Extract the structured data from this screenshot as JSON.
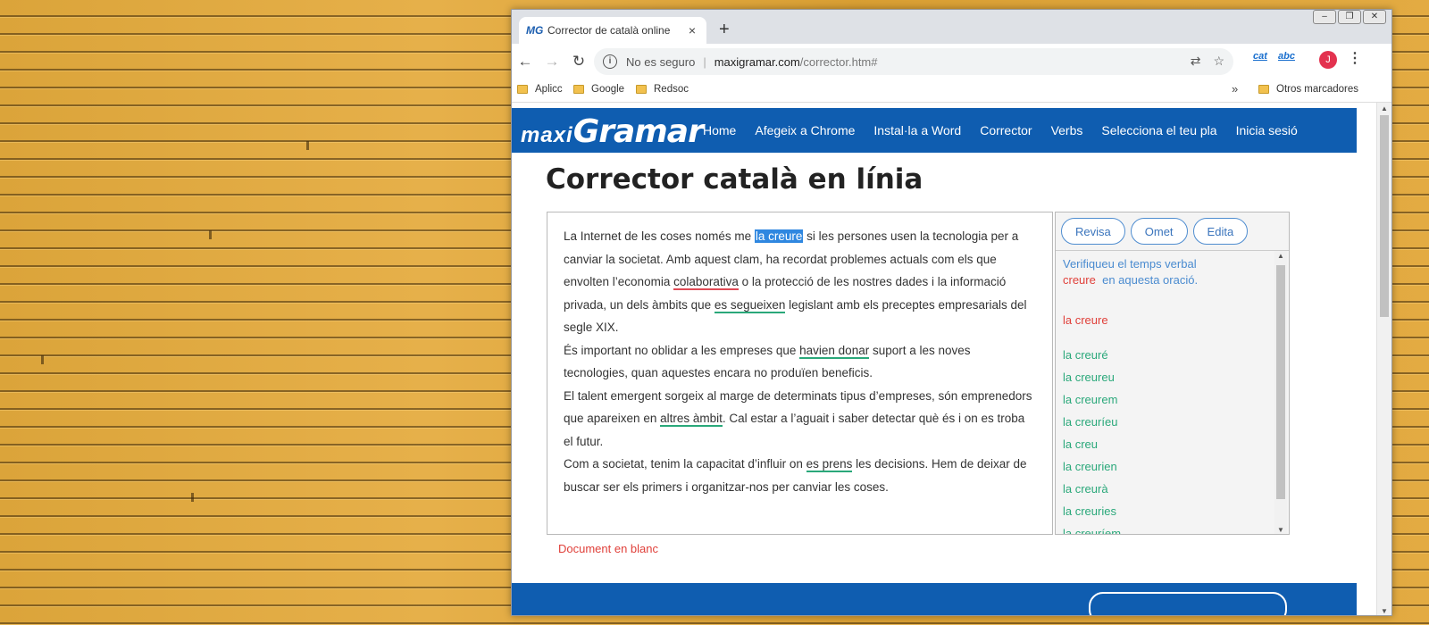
{
  "browser": {
    "tab_title": "Corrector de català online",
    "tab_favicon": "maxigramar-favicon",
    "tab_close": "×",
    "new_tab": "+",
    "address": {
      "security_label": "No es seguro",
      "host": "maxigramar.com",
      "path": "/corrector.htm#"
    },
    "extensions": [
      "cat",
      "abc"
    ],
    "avatar_letter": "J",
    "bookmarks": [
      "Aplicc",
      "Google",
      "Redsoc"
    ],
    "bookmarks_more": "»",
    "other_bookmarks": "Otros marcadores"
  },
  "site": {
    "logo_part1": "maxi",
    "logo_part2": "Gramar",
    "nav": [
      "Home",
      "Afegeix a Chrome",
      "Instal·la a Word",
      "Corrector",
      "Verbs",
      "Selecciona el teu pla",
      "Inicia sesió"
    ],
    "brand_color": "#0f5db0"
  },
  "page": {
    "heading": "Corrector català en línia",
    "blank_document": "Document en blanc"
  },
  "editor": {
    "p1": {
      "a": "La Internet de les coses només me ",
      "hl": "la creure",
      "b": " si les persones usen la tecnologia per a canviar la societat. Amb aquest clam, ha recordat problemes actuals com els que envolten l’economia ",
      "err1": "colaborativa",
      "c": " o la protecció de les nostres dades i la informació privada, un dels àmbits que ",
      "err2": "es segueixen",
      "d": " legislant amb els preceptes empresarials del segle XIX."
    },
    "p2": {
      "a": "És important no oblidar a les empreses que ",
      "err": "havien donar",
      "b": " suport a les noves tecnologies, quan aquestes encara no produïen beneficis."
    },
    "p3": {
      "a": "El talent emergent sorgeix al marge de determinats tipus d’empreses, són emprenedors que apareixen en ",
      "err": "altres àmbit",
      "b": ". Cal estar a l’aguait i saber detectar què és i on es troba el futur."
    },
    "p4": {
      "a": "Com a societat, tenim la capacitat d’influir on ",
      "err": "es prens",
      "b": " les decisions. Hem de deixar de buscar ser els primers i organitzar-nos per canviar les coses."
    }
  },
  "sidebar": {
    "buttons": [
      "Revisa",
      "Omet",
      "Edita"
    ],
    "message_a": "Verifiqueu el temps verbal",
    "message_word": "creure",
    "message_b": "en aquesta oració.",
    "original": "la creure",
    "suggestions": [
      "la creuré",
      "la creureu",
      "la creurem",
      "la creuríeu",
      "la creu",
      "la creurien",
      "la creurà",
      "la creuries",
      "la creuríem"
    ]
  }
}
